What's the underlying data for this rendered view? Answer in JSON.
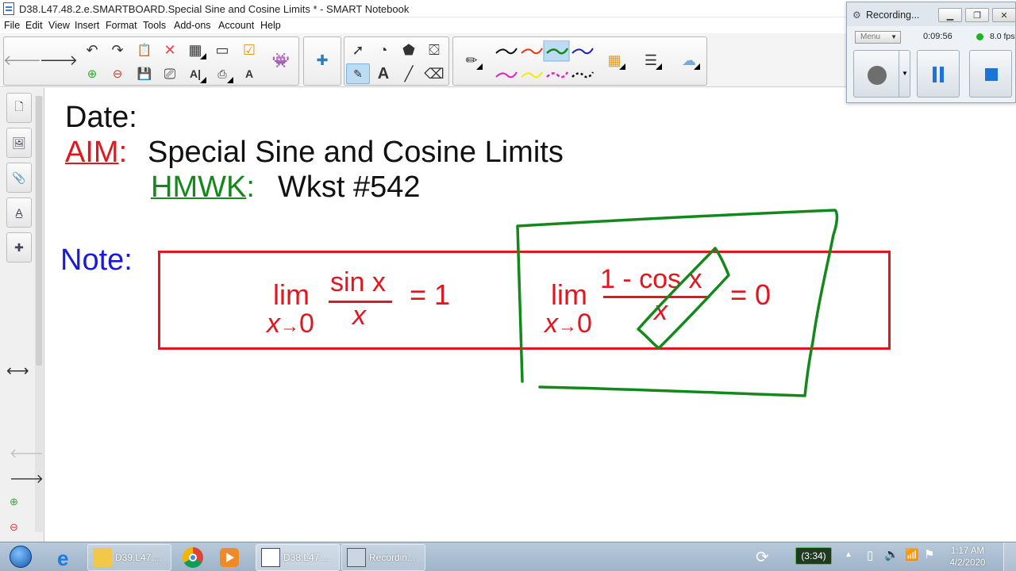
{
  "window": {
    "title": "D38.L47.48.2.e.SMARTBOARD.Special Sine and Cosine Limits * - SMART Notebook"
  },
  "menu": [
    "File",
    "Edit",
    "View",
    "Insert",
    "Format",
    "Tools",
    "Add-ons",
    "Account",
    "Help"
  ],
  "recorder": {
    "title": "Recording...",
    "menu_label": "Menu",
    "elapsed": "0:09:56",
    "fps": "8.0 fps"
  },
  "page": {
    "date_label": "Date:",
    "aim_label": "AIM",
    "aim_colon": ":",
    "aim_text": "Special Sine and Cosine Limits",
    "hmwk_label": "HMWK",
    "hmwk_colon": ":",
    "hmwk_text": "Wkst #542",
    "note_label": "Note:",
    "formula1": {
      "lim": "lim",
      "numerator": "sin x",
      "denominator": "x",
      "sub_var": "x",
      "sub_arrow": "→",
      "sub_target": "0",
      "equals": "= 1"
    },
    "formula2": {
      "lim": "lim",
      "numerator": "1 - cos x",
      "denominator": "x",
      "sub_var": "x",
      "sub_arrow": "→",
      "sub_target": "0",
      "equals": "= 0"
    }
  },
  "colors": {
    "ink_red": "#e3151e",
    "ink_green": "#13891b",
    "ink_blue": "#1b1bd6"
  },
  "taskbar": {
    "items": [
      {
        "label": "D39.L47....",
        "icon": "folder-icon"
      },
      {
        "label": "D38.L47....",
        "icon": "smart-notebook-icon"
      },
      {
        "label": "Recordin...",
        "icon": "recorder-icon"
      }
    ],
    "battery_timer": "(3:34)",
    "clock_time": "1:17 AM",
    "clock_date": "4/2/2020"
  }
}
